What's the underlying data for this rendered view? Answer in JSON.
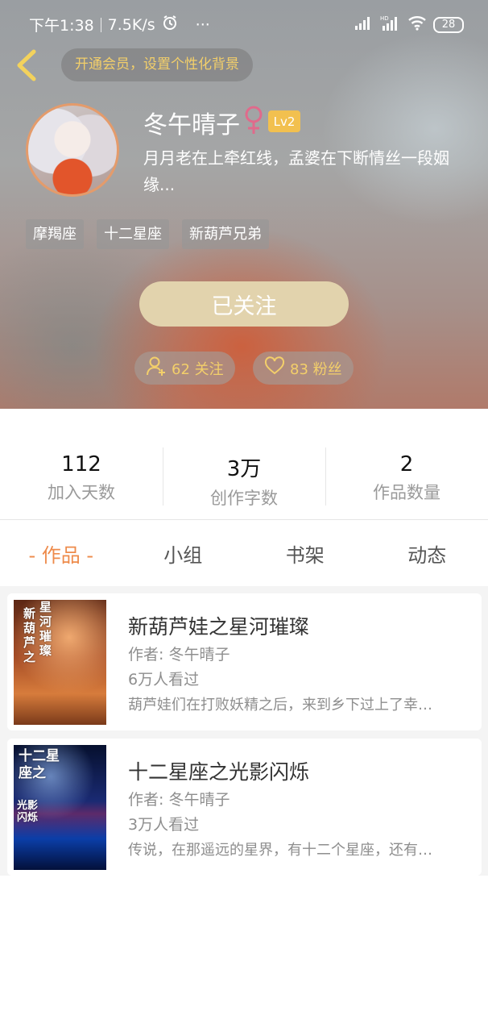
{
  "status_bar": {
    "time": "下午1:38",
    "net_speed": "7.5K/s",
    "more": "···",
    "battery": "28"
  },
  "header": {
    "vip_prompt": "开通会员，设置个性化背景",
    "nickname": "冬午晴子",
    "gender_symbol": "♀",
    "level": "Lv2",
    "bio": "月月老在上牵红线，孟婆在下断情丝一段姻缘...",
    "tags": [
      "摩羯座",
      "十二星座",
      "新葫芦兄弟"
    ],
    "follow_button": "已关注",
    "following": "62 关注",
    "fans": "83 粉丝"
  },
  "stats": [
    {
      "value": "112",
      "label": "加入天数"
    },
    {
      "value": "3万",
      "label": "创作字数"
    },
    {
      "value": "2",
      "label": "作品数量"
    }
  ],
  "tabs": [
    "- 作品 -",
    "小组",
    "书架",
    "动态"
  ],
  "works": [
    {
      "title": "新葫芦娃之星河璀璨",
      "author": "作者: 冬午晴子",
      "views": "6万人看过",
      "desc": "葫芦娃们在打败妖精之后，来到乡下过上了幸…",
      "cover_text": [
        "新葫芦之",
        "星河璀璨"
      ]
    },
    {
      "title": "十二星座之光影闪烁",
      "author": "作者: 冬午晴子",
      "views": "3万人看过",
      "desc": "传说，在那遥远的星界，有十二个星座，还有…",
      "cover_text": [
        "十二星座之",
        "光影闪烁"
      ]
    }
  ],
  "colors": {
    "accent_orange": "#ee8b4b",
    "gold_text": "#f3cf6a",
    "follow_button_bg": "#e2d3ad",
    "level_badge_bg": "#f2c04f",
    "gender_pink": "#e06a8b"
  },
  "icons": {
    "back": "chevron-left-icon",
    "alarm": "alarm-clock-icon",
    "signal": "cell-signal-icon",
    "wifi": "wifi-icon",
    "battery": "battery-icon",
    "following": "user-plus-icon",
    "fans": "heart-icon"
  }
}
